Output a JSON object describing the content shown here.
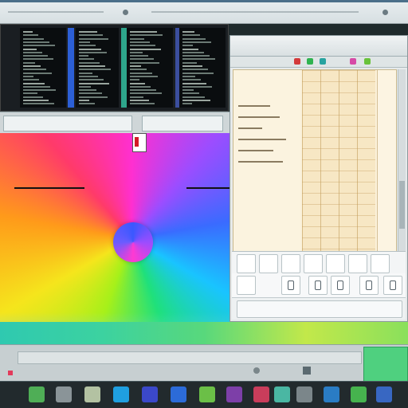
{
  "colors": {
    "accent": "#3a58ff",
    "wheel_center": "#9b4dff",
    "doc_paper": "#fbf1da",
    "dock_bg": "#222a2d"
  },
  "screen": {
    "title_bar": {
      "icons": [
        "window-dot-icon",
        "window-dot-icon"
      ]
    },
    "code_window": {
      "pane_count": 4
    },
    "color_wheel": {
      "icon": "color-wheel"
    },
    "document_window": {
      "toolbar_icons": [
        "red-icon",
        "green-icon",
        "teal-icon",
        "pink-icon",
        "lime-icon"
      ]
    },
    "tool_palette": {
      "rows": 3
    },
    "timeline": {},
    "dock": {
      "icon_count": 14
    }
  }
}
